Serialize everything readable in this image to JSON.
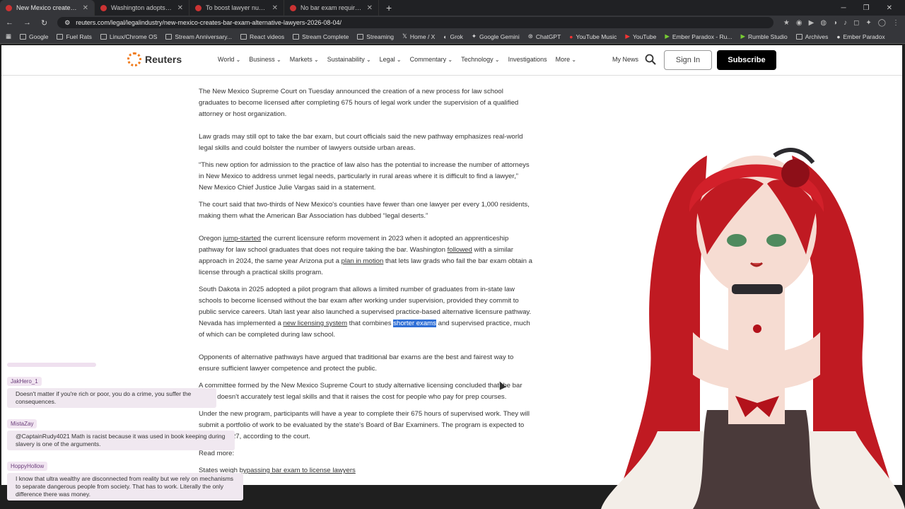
{
  "browser": {
    "tabs": [
      {
        "title": "New Mexico creates bar e",
        "active": true
      },
      {
        "title": "Washington adopts new lawye",
        "active": false
      },
      {
        "title": "To boost lawyer numbers in 'le",
        "active": false
      },
      {
        "title": "No bar exam required to pract",
        "active": false
      }
    ],
    "new_tab": "+",
    "url": "reuters.com/legal/legalindustry/new-mexico-creates-bar-exam-alternative-lawyers-2026-08-04/",
    "bookmarks": [
      "Google",
      "Fuel Rats",
      "Linux/Chrome OS",
      "Stream Anniversary...",
      "React videos",
      "Stream Complete",
      "Streaming",
      "Home / X",
      "Grok",
      "Google Gemini",
      "ChatGPT",
      "YouTube Music",
      "YouTube",
      "Ember Paradox - Ru...",
      "Rumble Studio",
      "Archives",
      "Ember Paradox"
    ]
  },
  "site": {
    "logo": "Reuters",
    "nav": [
      "World",
      "Business",
      "Markets",
      "Sustainability",
      "Legal",
      "Commentary",
      "Technology",
      "Investigations",
      "More"
    ],
    "my_news": "My News",
    "sign_in": "Sign In",
    "subscribe": "Subscribe"
  },
  "article": {
    "p1": "The New Mexico Supreme Court on Tuesday announced the creation of a new process for law school graduates to become licensed after completing 675 hours of legal work under the supervision of a qualified attorney or host organization.",
    "p2": "Law grads may still opt to take the bar exam, but court officials said the new pathway emphasizes real-world legal skills and could bolster the number of lawyers outside urban areas.",
    "p3": "“This new option for admission to the practice of law also has the potential to increase the number of attorneys in New Mexico to address unmet legal needs, particularly in rural areas where it is difficult to find a lawyer,” New Mexico Chief Justice Julie Vargas said in a statement.",
    "p4": "The court said that two-thirds of New Mexico's counties have fewer than one lawyer per every 1,000 residents, making them what the American Bar Association has dubbed “legal deserts.”",
    "p5_a": "Oregon ",
    "p5_link1": "jump-started",
    "p5_b": " the current licensure reform movement in 2023 when it adopted an apprenticeship pathway for law school graduates that does not require taking the bar. Washington ",
    "p5_link2": "followed",
    "p5_c": " with a similar approach in 2024, the same year Arizona put a ",
    "p5_link3": "plan in motion",
    "p5_d": " that lets law grads who fail the bar exam obtain a license through a practical skills program.",
    "p6_a": "South Dakota in 2025 adopted a pilot program that allows a limited number of graduates from in-state law schools to become licensed without the bar exam after working under supervision, provided they commit to public service careers. Utah last year also launched a supervised practice-based alternative licensure pathway. Nevada has implemented a ",
    "p6_link": "new licensing system",
    "p6_b": " that combines ",
    "p6_hl": "shorter exams",
    "p6_c": " and supervised practice, much of which can be completed during law school.",
    "p7": "Opponents of alternative pathways have argued that traditional bar exams are the best and fairest way to ensure sufficient lawyer competence and protect the public.",
    "p8": "A committee formed by the New Mexico Supreme Court to study alternative licensing concluded that the bar exam doesn't accurately test legal skills and that it raises the cost for people who pay for prep courses.",
    "p9": "Under the new program, participants will have a year to complete their 675 hours of supervised work. They will submit a portfolio of work to be evaluated by the state's Board of Bar Examiners. The program is expected to begin in 2027, according to the court.",
    "read_more": "Read more:",
    "rm1": "States weigh bypassing bar exam to license lawyers"
  },
  "chat": [
    {
      "user": "JakHero_1",
      "text": "Doesn't matter if you're rich or poor, you do a crime, you suffer the consequences."
    },
    {
      "user": "MistaZay",
      "text": "@CaptainRudy4021 Math is racist because it was used in book keeping during slavery is one of the arguments."
    },
    {
      "user": "HoppyHollow",
      "text": "I know that ultra wealthy are disconnected from reality but we rely on mechanisms to separate dangerous people from society. That has to work. Literally the only difference there was money."
    }
  ]
}
